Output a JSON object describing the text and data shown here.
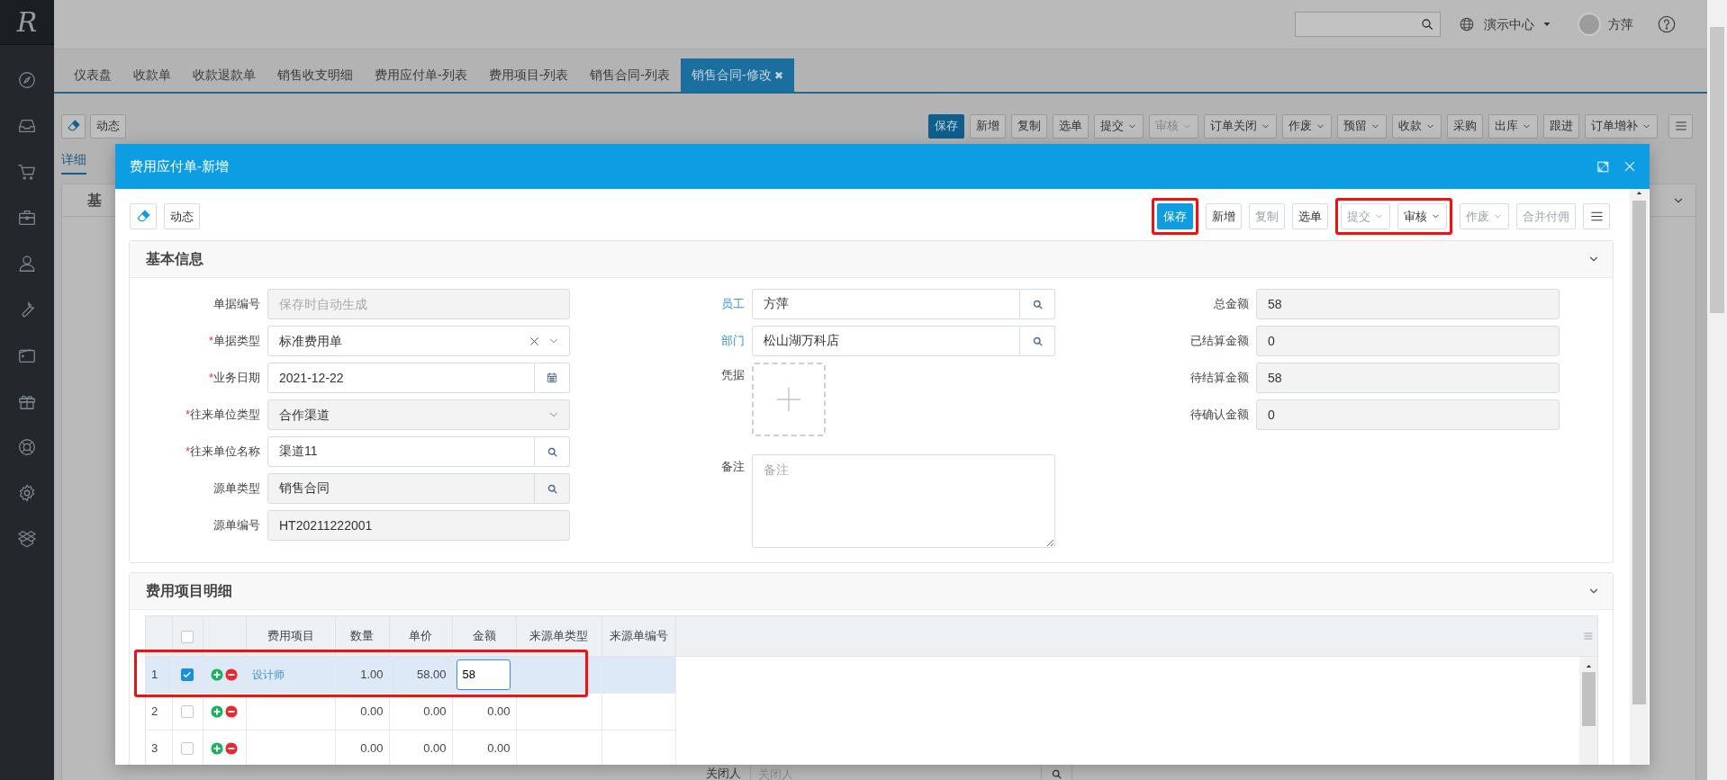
{
  "sidebar": {
    "logo": "R"
  },
  "top_bar": {
    "org": "演示中心",
    "user": "方萍"
  },
  "tabs": [
    {
      "label": "仪表盘",
      "selected": false
    },
    {
      "label": "收款单",
      "selected": false
    },
    {
      "label": "收款退款单",
      "selected": false
    },
    {
      "label": "销售收支明细",
      "selected": false
    },
    {
      "label": "费用应付单-列表",
      "selected": false
    },
    {
      "label": "费用项目-列表",
      "selected": false
    },
    {
      "label": "销售合同-列表",
      "selected": false
    },
    {
      "label": "销售合同-修改",
      "selected": true,
      "close_mark": "✖"
    }
  ],
  "page_toolbar": {
    "left": "动态",
    "buttons": [
      {
        "label": "保存",
        "kind": "primary",
        "dropdown": false,
        "disabled": false
      },
      {
        "label": "新增",
        "kind": "default",
        "dropdown": false,
        "disabled": false
      },
      {
        "label": "复制",
        "kind": "default",
        "dropdown": false,
        "disabled": false
      },
      {
        "label": "选单",
        "kind": "default",
        "dropdown": false,
        "disabled": false
      },
      {
        "label": "提交",
        "kind": "default",
        "dropdown": true,
        "disabled": false
      },
      {
        "label": "审核",
        "kind": "default",
        "dropdown": true,
        "disabled": true
      },
      {
        "label": "订单关闭",
        "kind": "default",
        "dropdown": true,
        "disabled": false
      },
      {
        "label": "作废",
        "kind": "default",
        "dropdown": true,
        "disabled": false
      },
      {
        "label": "预留",
        "kind": "default",
        "dropdown": true,
        "disabled": false
      },
      {
        "label": "收款",
        "kind": "default",
        "dropdown": true,
        "disabled": false
      },
      {
        "label": "采购",
        "kind": "default",
        "dropdown": false,
        "disabled": false
      },
      {
        "label": "出库",
        "kind": "default",
        "dropdown": true,
        "disabled": false
      },
      {
        "label": "跟进",
        "kind": "default",
        "dropdown": false,
        "disabled": false
      },
      {
        "label": "订单增补",
        "kind": "default",
        "dropdown": true,
        "disabled": false
      }
    ]
  },
  "page_detail": {
    "tab": "详细",
    "section": "基",
    "footer_label": "关闭人",
    "footer_placeholder": "关闭人"
  },
  "modal": {
    "title": "费用应付单-新增",
    "toolbar": {
      "left": "动态",
      "buttons": [
        {
          "label": "保存",
          "kind": "primary",
          "dropdown": false,
          "disabled": false,
          "highlighted": true
        },
        {
          "label": "新增",
          "kind": "default",
          "dropdown": false,
          "disabled": false,
          "highlighted": false
        },
        {
          "label": "复制",
          "kind": "default",
          "dropdown": false,
          "disabled": true,
          "highlighted": false
        },
        {
          "label": "选单",
          "kind": "default",
          "dropdown": false,
          "disabled": false,
          "highlighted": false
        },
        {
          "label": "提交",
          "kind": "default",
          "dropdown": true,
          "disabled": true,
          "highlighted": true
        },
        {
          "label": "审核",
          "kind": "default",
          "dropdown": true,
          "disabled": false,
          "highlighted": true
        },
        {
          "label": "作废",
          "kind": "default",
          "dropdown": true,
          "disabled": true,
          "highlighted": false
        },
        {
          "label": "合并付佣",
          "kind": "default",
          "dropdown": false,
          "disabled": true,
          "highlighted": false
        }
      ]
    },
    "basic_info": {
      "title": "基本信息",
      "columns": [
        [
          {
            "label": "单据编号",
            "kind": "text",
            "readonly": true,
            "placeholder": "保存时自动生成"
          },
          {
            "label": "单据类型",
            "mark": "*",
            "kind": "select",
            "readonly": false,
            "clearable": true,
            "value": "标准费用单"
          },
          {
            "label": "业务日期",
            "mark": "*",
            "kind": "date",
            "readonly": false,
            "value": "2021-12-22"
          },
          {
            "label": "往来单位类型",
            "mark": "*",
            "kind": "select",
            "readonly": true,
            "clearable": false,
            "value": "合作渠道"
          },
          {
            "label": "往来单位名称",
            "mark": "*",
            "kind": "search",
            "readonly": false,
            "value": "渠道11"
          },
          {
            "label": "源单类型",
            "kind": "search",
            "readonly": true,
            "value": "销售合同"
          },
          {
            "label": "源单编号",
            "kind": "text",
            "readonly": true,
            "value": "HT20211222001"
          }
        ],
        [
          {
            "label": "员工",
            "link": true,
            "kind": "search",
            "readonly": false,
            "value": "方萍"
          },
          {
            "label": "部门",
            "link": true,
            "kind": "search",
            "readonly": false,
            "value": "松山湖万科店"
          },
          {
            "label": "凭据",
            "link": false,
            "kind": "upload"
          },
          {
            "label": "备注",
            "link": false,
            "kind": "textarea",
            "placeholder": "备注"
          }
        ],
        [
          {
            "label": "总金额",
            "kind": "text",
            "readonly": true,
            "value": "58"
          },
          {
            "label": "已结算金额",
            "kind": "text",
            "readonly": true,
            "value": "0"
          },
          {
            "label": "待结算金额",
            "kind": "text",
            "readonly": true,
            "value": "58"
          },
          {
            "label": "待确认金额",
            "kind": "text",
            "readonly": true,
            "value": "0"
          }
        ]
      ]
    },
    "detail": {
      "title": "费用项目明细",
      "header_checked": false,
      "columns": [
        "费用项目",
        "数量",
        "单价",
        "金额",
        "来源单类型",
        "来源单编号"
      ],
      "rows": [
        {
          "index": "1",
          "checked": true,
          "selected": true,
          "highlighted": true,
          "item": "设计师",
          "qty": "1.00",
          "price": "58.00",
          "amount": "58",
          "editing": true
        },
        {
          "index": "2",
          "checked": false,
          "selected": false,
          "highlighted": false,
          "qty": "0.00",
          "price": "0.00",
          "amount": "0.00",
          "editing": false
        },
        {
          "index": "3",
          "checked": false,
          "selected": false,
          "highlighted": false,
          "qty": "0.00",
          "price": "0.00",
          "amount": "0.00",
          "editing": false
        }
      ]
    }
  }
}
